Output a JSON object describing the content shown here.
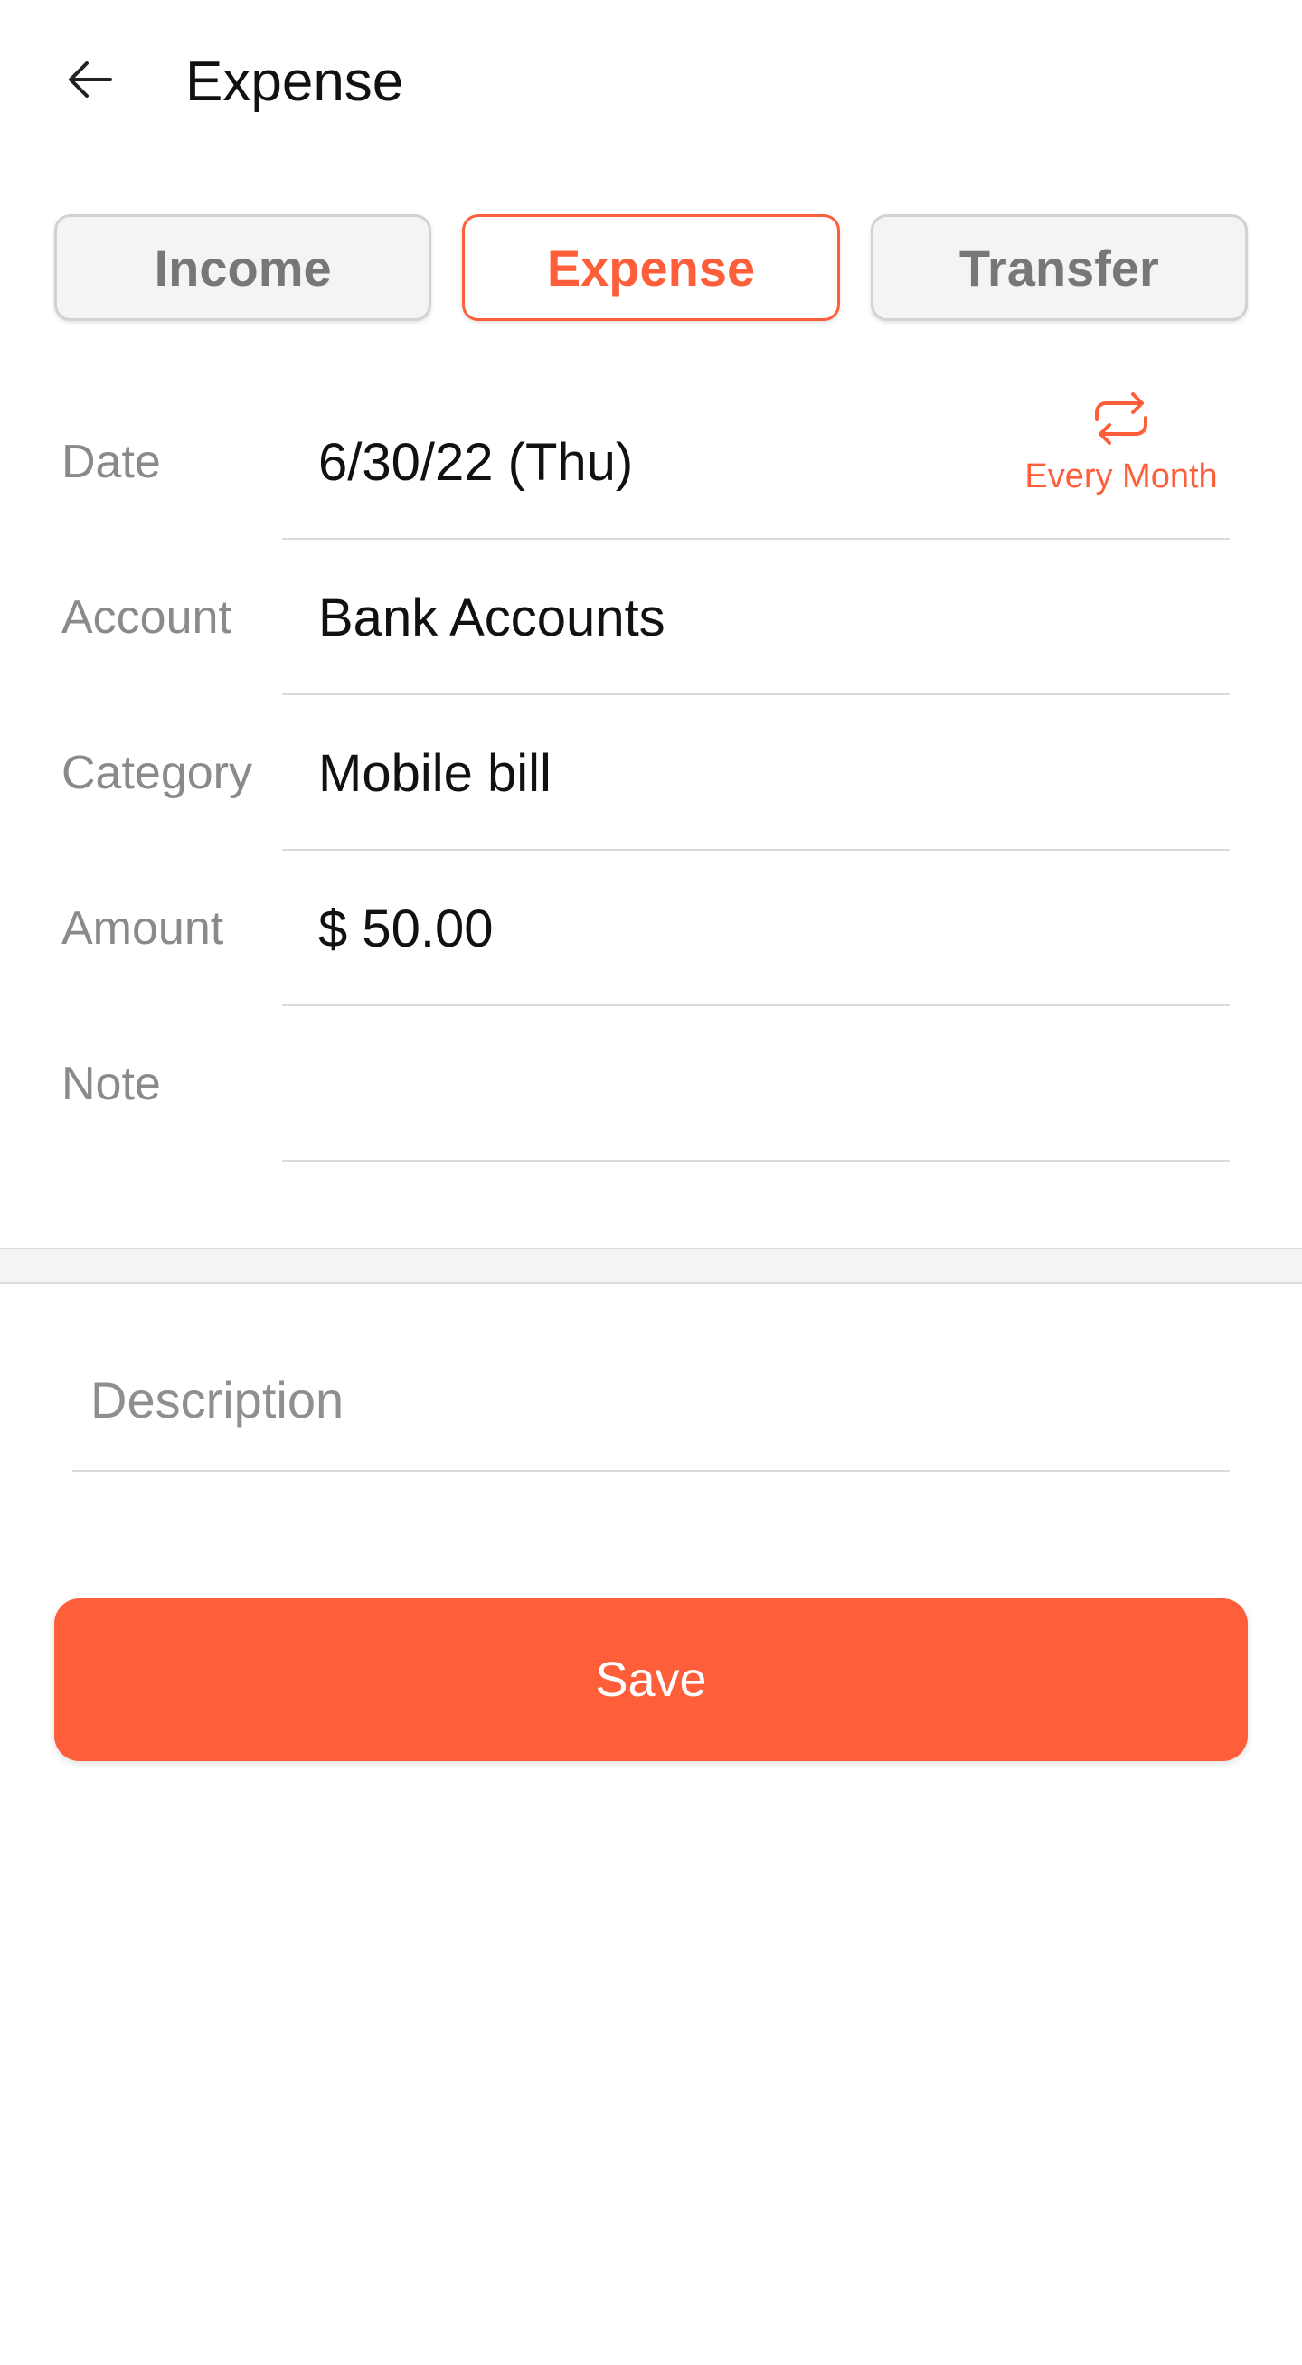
{
  "header": {
    "title": "Expense",
    "back_icon": "arrow-left-icon"
  },
  "tabs": [
    {
      "label": "Income",
      "active": false
    },
    {
      "label": "Expense",
      "active": true
    },
    {
      "label": "Transfer",
      "active": false
    }
  ],
  "form": {
    "date": {
      "label": "Date",
      "value": "6/30/22 (Thu)"
    },
    "repeat": {
      "label": "Every Month",
      "icon": "repeat-icon"
    },
    "account": {
      "label": "Account",
      "value": "Bank Accounts"
    },
    "category": {
      "label": "Category",
      "value": "Mobile bill"
    },
    "amount": {
      "label": "Amount",
      "value": "$ 50.00"
    },
    "note": {
      "label": "Note",
      "value": ""
    }
  },
  "description": {
    "placeholder": "Description",
    "value": ""
  },
  "save_label": "Save",
  "colors": {
    "accent": "#ff5e3a",
    "label_gray": "#8a8a8a",
    "divider": "#dadada"
  }
}
